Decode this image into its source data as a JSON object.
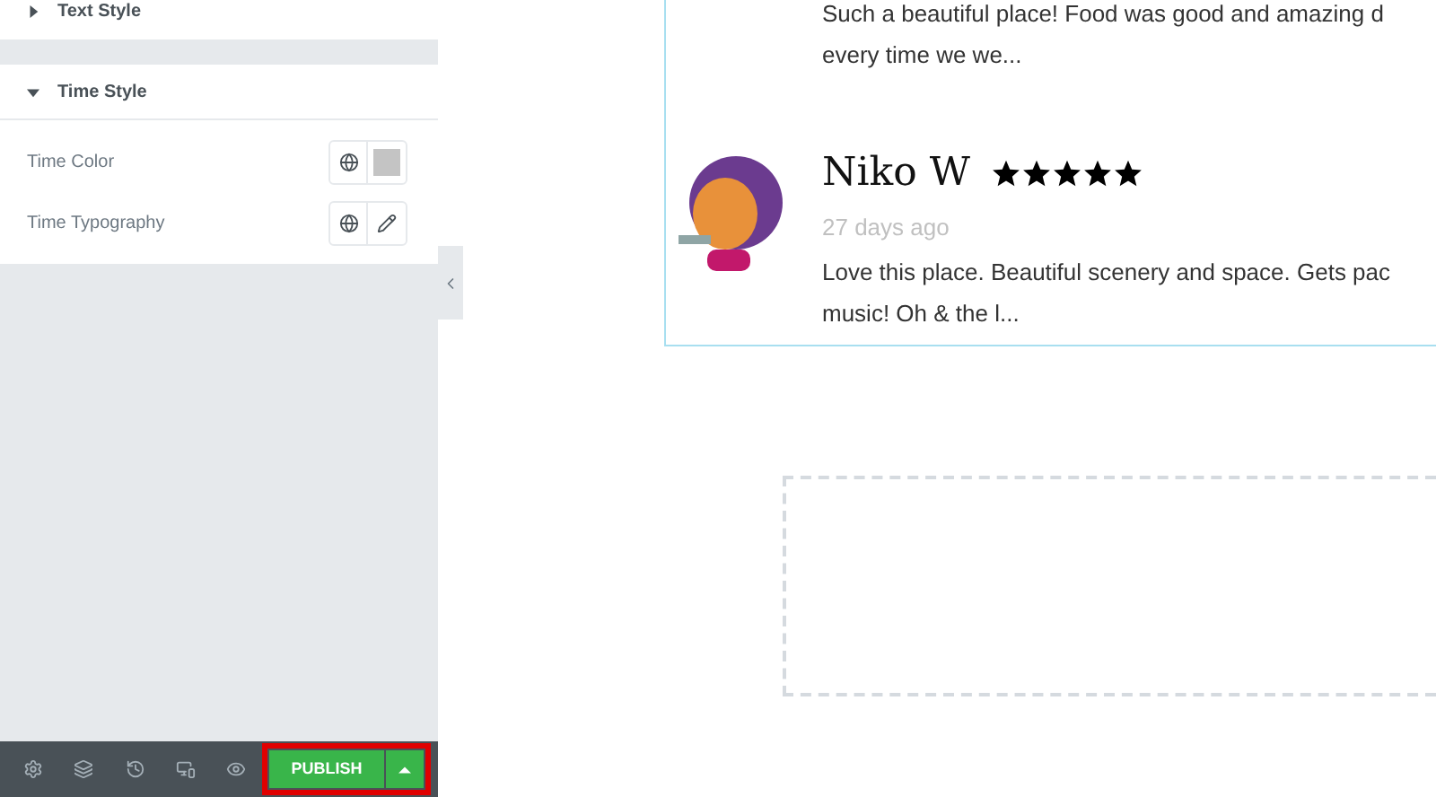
{
  "panel": {
    "sections": [
      {
        "title": "Text Style",
        "expanded": false
      },
      {
        "title": "Time Style",
        "expanded": true,
        "controls": [
          {
            "label": "Time Color",
            "kind": "color",
            "color": "#c4c4c4"
          },
          {
            "label": "Time Typography",
            "kind": "typography"
          }
        ]
      }
    ]
  },
  "bottom_bar": {
    "publish": "PUBLISH"
  },
  "reviews": [
    {
      "text_lines": [
        "Such a beautiful place! Food was good and amazing d",
        "every time we we..."
      ]
    },
    {
      "name": "Niko W",
      "stars": 5,
      "time": "27 days ago",
      "text_lines": [
        "Love this place. Beautiful scenery and space. Gets pac",
        "music! Oh & the l..."
      ]
    }
  ]
}
